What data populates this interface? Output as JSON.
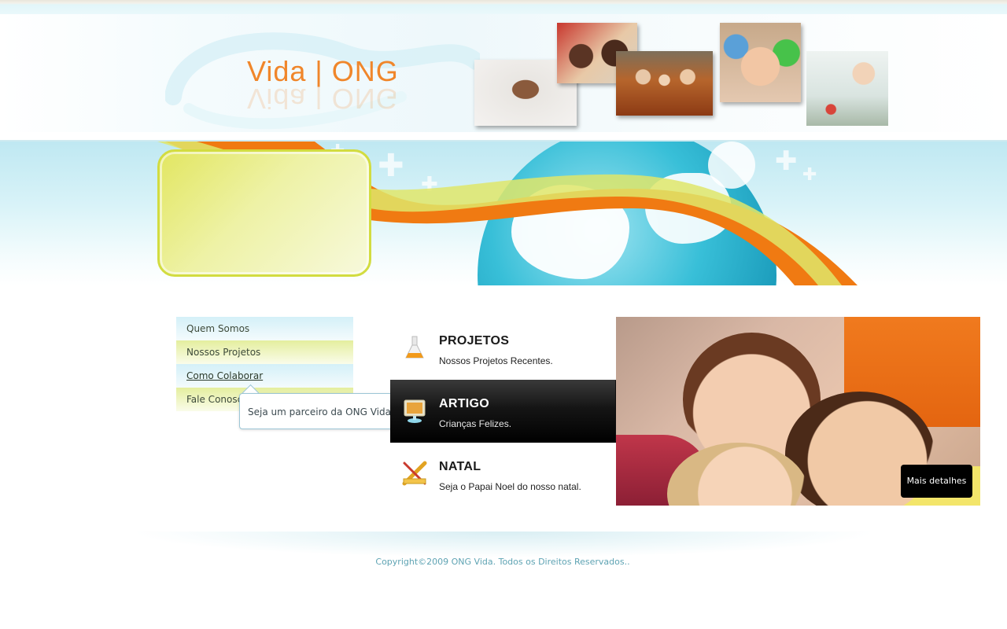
{
  "logo": {
    "text": "Vida | ONG"
  },
  "nav": {
    "items": [
      {
        "label": "Quem Somos"
      },
      {
        "label": "Nossos Projetos"
      },
      {
        "label": "Como Colaborar"
      },
      {
        "label": "Fale Conosco"
      }
    ],
    "active_index": 2,
    "tooltip": "Seja um parceiro da ONG Vida"
  },
  "features": [
    {
      "title": "PROJETOS",
      "subtitle": "Nossos Projetos Recentes.",
      "icon": "flask-icon"
    },
    {
      "title": "ARTIGO",
      "subtitle": "Crianças Felizes.",
      "icon": "monitor-icon"
    },
    {
      "title": "NATAL",
      "subtitle": "Seja o Papai Noel do nosso natal.",
      "icon": "tools-icon"
    }
  ],
  "hero": {
    "button_label": "Mais detalhes"
  },
  "footer": {
    "copyright": "Copyright©2009 ONG Vida. Todos os Direitos Reservados.."
  },
  "colors": {
    "brand": "#f0862a",
    "accent_green": "#dfe55a",
    "accent_blue": "#38bfd8",
    "footer_text": "#5ea3b3"
  }
}
